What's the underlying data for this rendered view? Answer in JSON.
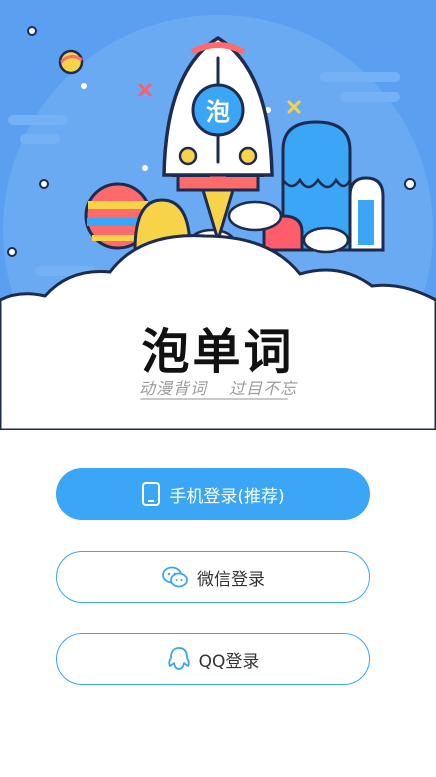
{
  "app": {
    "logo_text": "泡单词",
    "rocket_badge": "泡",
    "slogan_left": "动漫背词",
    "slogan_right": "过目不忘"
  },
  "buttons": {
    "phone_login": "手机登录(推荐)",
    "wechat_login": "微信登录",
    "qq_login": "QQ登录"
  },
  "icons": {
    "phone": "phone-icon",
    "wechat": "wechat-icon",
    "qq": "qq-icon"
  },
  "colors": {
    "primary": "#3aa6f5",
    "sky": "#5b9ff0"
  }
}
